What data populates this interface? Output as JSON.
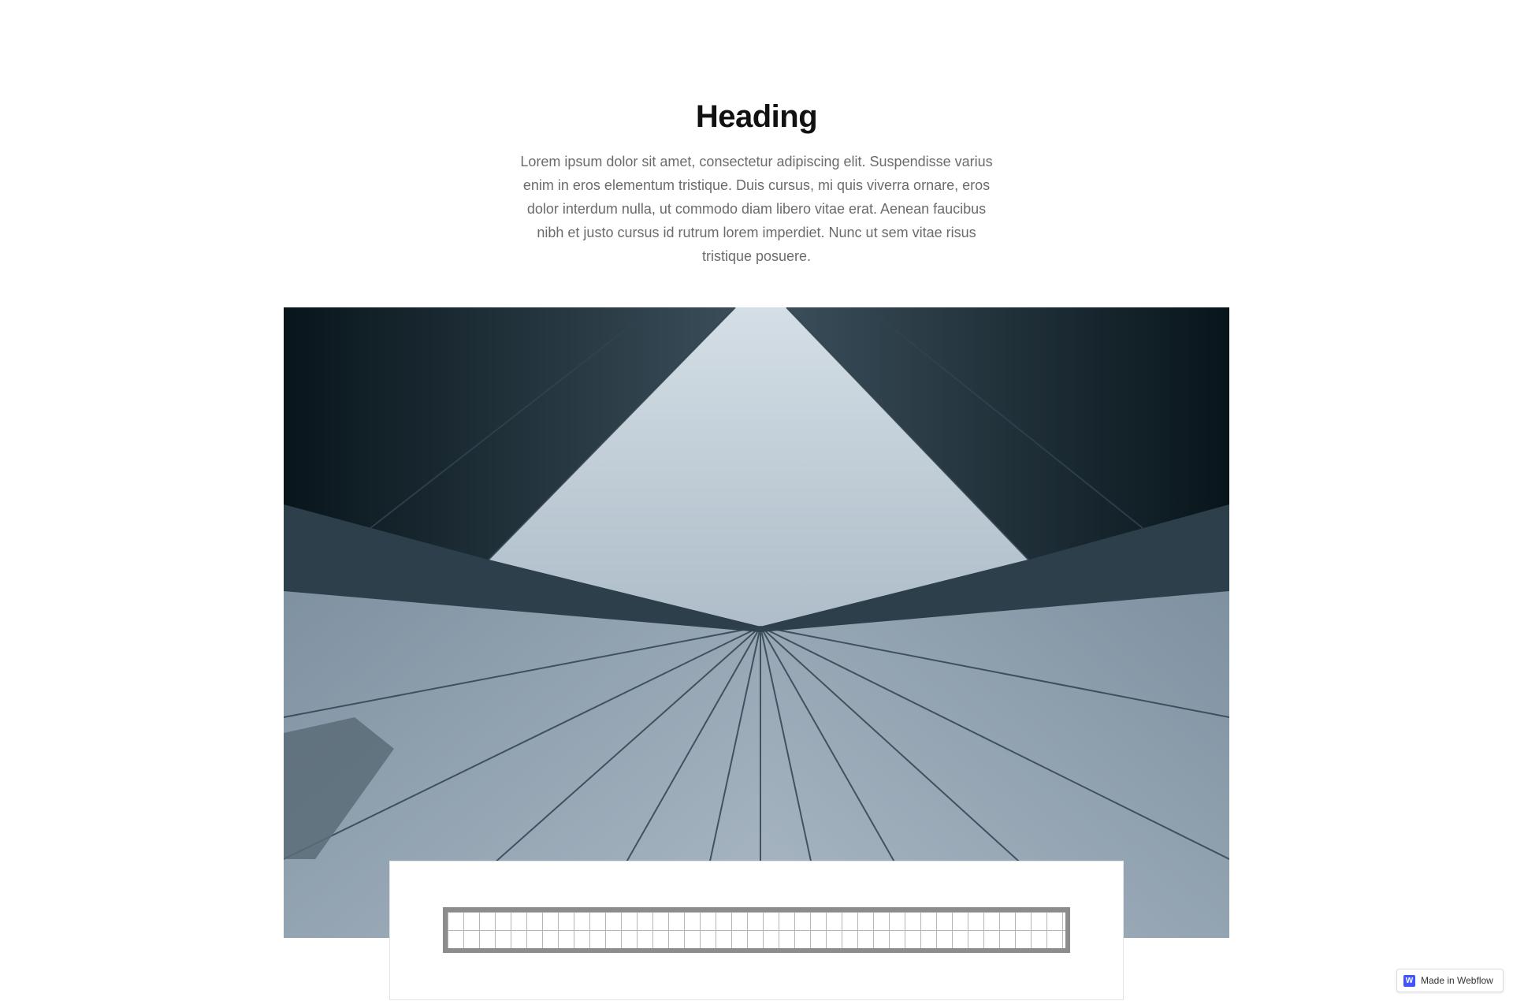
{
  "header": {
    "heading": "Heading",
    "body": "Lorem ipsum dolor sit amet, consectetur adipiscing elit. Suspendisse varius enim in eros elementum tristique. Duis cursus, mi quis viverra ornare, eros dolor interdum nulla, ut commodo diam libero vitae erat. Aenean faucibus nibh et justo cursus id rutrum lorem imperdiet. Nunc ut sem vitae risus tristique posuere."
  },
  "hero_image": {
    "icon": "skyscraper-upward-photo"
  },
  "card": {
    "element": "grid-placeholder"
  },
  "badge": {
    "logo_letter": "W",
    "label": "Made in Webflow",
    "logo_color": "#4353ff"
  },
  "colors": {
    "heading": "#111111",
    "body_text": "#6b6b6b",
    "background": "#ffffff"
  }
}
